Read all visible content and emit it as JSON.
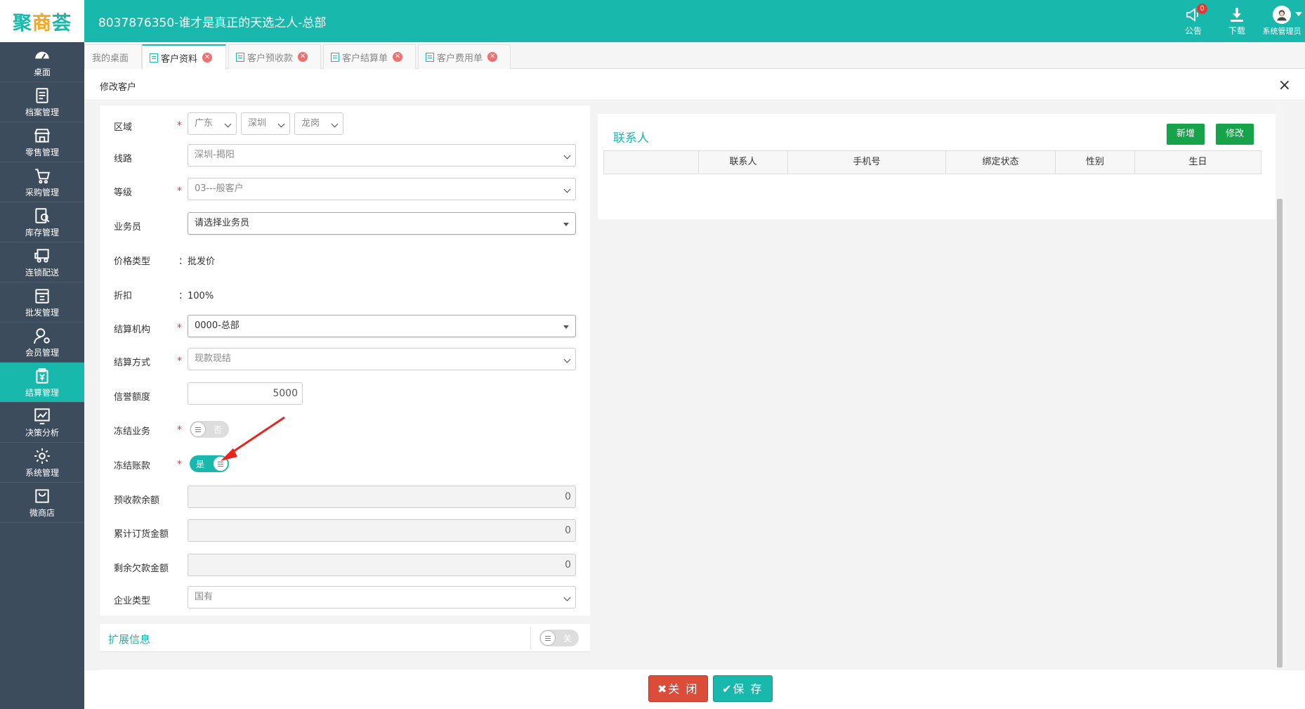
{
  "app": {
    "logo": [
      "聚",
      "商",
      "荟"
    ],
    "title": "8037876350-谁才是真正的天选之人-总部"
  },
  "top_actions": {
    "announce_label": "公告",
    "announce_count": "0",
    "download_label": "下载",
    "user_label": "系统管理员"
  },
  "sidebar": {
    "items": [
      {
        "label": "桌面",
        "icon": "dashboard-icon"
      },
      {
        "label": "档案管理",
        "icon": "archive-icon"
      },
      {
        "label": "零售管理",
        "icon": "store-icon"
      },
      {
        "label": "采购管理",
        "icon": "cart-icon"
      },
      {
        "label": "库存管理",
        "icon": "inventory-icon"
      },
      {
        "label": "连锁配送",
        "icon": "truck-icon"
      },
      {
        "label": "批发管理",
        "icon": "wholesale-icon"
      },
      {
        "label": "会员管理",
        "icon": "member-icon"
      },
      {
        "label": "结算管理",
        "icon": "settlement-icon"
      },
      {
        "label": "决策分析",
        "icon": "chart-icon"
      },
      {
        "label": "系统管理",
        "icon": "gear-icon"
      },
      {
        "label": "微商店",
        "icon": "shop-bag-icon"
      }
    ],
    "active_index": 8
  },
  "tabs": [
    {
      "label": "我的桌面"
    },
    {
      "label": "客户资料"
    },
    {
      "label": "客户预收款"
    },
    {
      "label": "客户结算单"
    },
    {
      "label": "客户费用单"
    }
  ],
  "window": {
    "title": "修改客户",
    "close_glyph": "×"
  },
  "form": {
    "region_label": "区域",
    "region_province": "广东",
    "region_city": "深圳",
    "region_district": "龙岗",
    "route_label": "线路",
    "route_value": "深圳-揭阳",
    "level_label": "等级",
    "level_value": "03---般客户",
    "salesman_label": "业务员",
    "salesman_value": "请选择业务员",
    "price_type_label": "价格类型",
    "price_type_value": "：批发价",
    "discount_label": "折扣",
    "discount_value": "：100%",
    "settle_org_label": "结算机构",
    "settle_org_value": "0000-总部",
    "settle_method_label": "结算方式",
    "settle_method_value": "现款现结",
    "credit_label": "信誉额度",
    "credit_value": "5000",
    "freeze_business_label": "冻结业务",
    "freeze_business_toggle": "否",
    "freeze_account_label": "冻结账款",
    "freeze_account_toggle": "是",
    "prepay_balance_label": "预收款余额",
    "prepay_balance_value": "0",
    "total_order_label": "累计订货金额",
    "total_order_value": "0",
    "remaining_debt_label": "剩余欠款金额",
    "remaining_debt_value": "0",
    "enterprise_type_label": "企业类型",
    "enterprise_type_value": "国有",
    "required_mark": "*"
  },
  "extension": {
    "title": "扩展信息",
    "toggle": "关"
  },
  "contacts": {
    "title": "联系人",
    "add_label": "新增",
    "edit_label": "修改",
    "columns": [
      "",
      "联系人",
      "手机号",
      "绑定状态",
      "性别",
      "生日"
    ]
  },
  "footer": {
    "close_label": "✖关 闭",
    "save_label": "✔保 存"
  },
  "colors": {
    "brand": "#18b9ac",
    "sidebar": "#3d4c5d",
    "danger": "#dd4b39",
    "green_button": "#16a34a"
  }
}
